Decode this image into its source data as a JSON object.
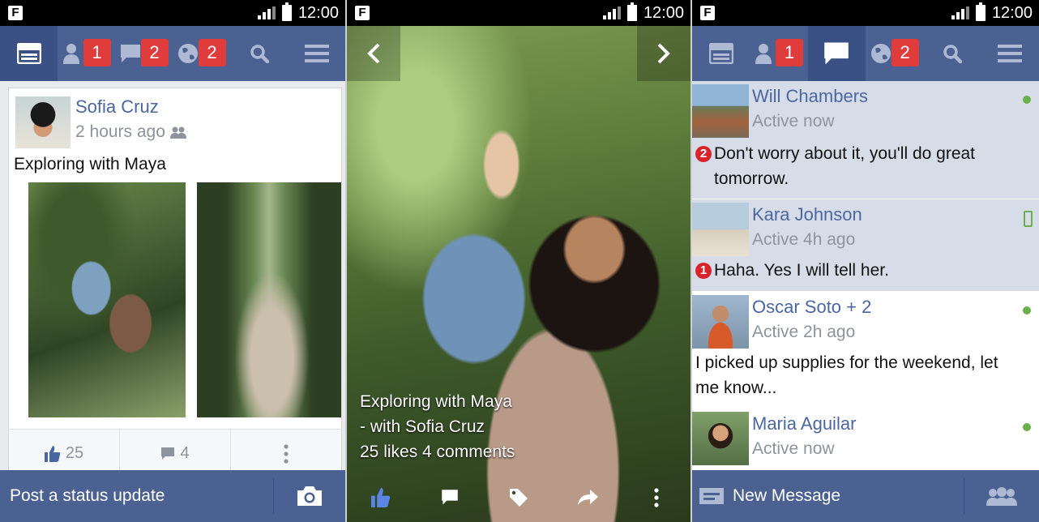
{
  "status": {
    "time": "12:00",
    "fb_icon": "F"
  },
  "nav_badges": {
    "friends": "1",
    "messages": "2",
    "notifications": "2"
  },
  "feed": {
    "author": "Sofia Cruz",
    "timestamp": "2 hours ago",
    "caption": "Exploring with Maya",
    "likes": "25",
    "comments": "4",
    "post_placeholder": "Post a status update"
  },
  "viewer": {
    "caption_line1": "Exploring with Maya",
    "caption_line2": "- with Sofia Cruz",
    "caption_line3": "25 likes 4 comments"
  },
  "messages": {
    "threads": [
      {
        "name": "Will Chambers",
        "status": "Active now",
        "count": "2",
        "message": "Don't worry about it, you'll do great tomorrow.",
        "presence": "online"
      },
      {
        "name": "Kara Johnson",
        "status": "Active 4h ago",
        "count": "1",
        "message": "Haha. Yes I will tell her.",
        "presence": "mobile"
      },
      {
        "name": "Oscar Soto + 2",
        "status": "Active 2h ago",
        "message": "I picked up supplies for the weekend, let me know...",
        "presence": "online"
      },
      {
        "name": "Maria Aguilar",
        "status": "Active now",
        "presence": "online"
      }
    ],
    "new_message_label": "New Message"
  },
  "colors": {
    "brand": "#4a6192",
    "brand_dark": "#3b5085",
    "badge": "#e03c3c",
    "online": "#6ab04c",
    "link": "#4b67a1"
  }
}
